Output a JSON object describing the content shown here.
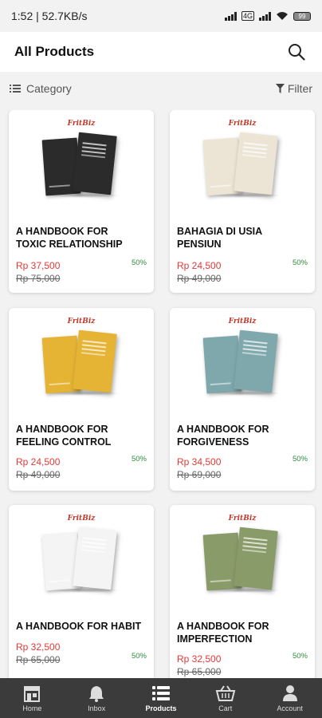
{
  "status_bar": {
    "time": "1:52 | 52.7KB/s",
    "battery": "99"
  },
  "header": {
    "title": "All Products"
  },
  "filter_bar": {
    "category_label": "Category",
    "filter_label": "Filter"
  },
  "products": [
    {
      "name": "  A HANDBOOK FOR\nTOXIC RELATIONSHIP",
      "price": "Rp 37,500",
      "original_price": "Rp 75,000",
      "discount": "50%",
      "brand": "FritBiz",
      "cover_color": "#2b2b2b"
    },
    {
      "name": "  BAHAGIA DI USIA\nPENSIUN",
      "price": "Rp 24,500",
      "original_price": "Rp 49,000",
      "discount": "50%",
      "brand": "FritBiz",
      "cover_color": "#ece5d6"
    },
    {
      "name": "  A HANDBOOK FOR\nFEELING CONTROL",
      "price": "Rp 24,500",
      "original_price": "Rp 49,000",
      "discount": "50%",
      "brand": "FritBiz",
      "cover_color": "#e6b435"
    },
    {
      "name": "  A HANDBOOK FOR\nFORGIVENESS",
      "price": "Rp 34,500",
      "original_price": "Rp 69,000",
      "discount": "50%",
      "brand": "FritBiz",
      "cover_color": "#7fa8ad"
    },
    {
      "name": "  A HANDBOOK FOR HABIT",
      "price": "Rp 32,500",
      "original_price": "Rp 65,000",
      "discount": "50%",
      "brand": "FritBiz",
      "cover_color": "#f4f4f4"
    },
    {
      "name": "  A HANDBOOK FOR\nIMPERFECTION",
      "price": "Rp 32,500",
      "original_price": "Rp 65,000",
      "discount": "50%",
      "brand": "FritBiz",
      "cover_color": "#8a9b6a"
    }
  ],
  "bottom_nav": [
    {
      "label": "Home",
      "icon": "store-icon"
    },
    {
      "label": "Inbox",
      "icon": "bell-icon"
    },
    {
      "label": "Products",
      "icon": "list-icon",
      "active": true
    },
    {
      "label": "Cart",
      "icon": "basket-icon"
    },
    {
      "label": "Account",
      "icon": "person-icon"
    }
  ]
}
